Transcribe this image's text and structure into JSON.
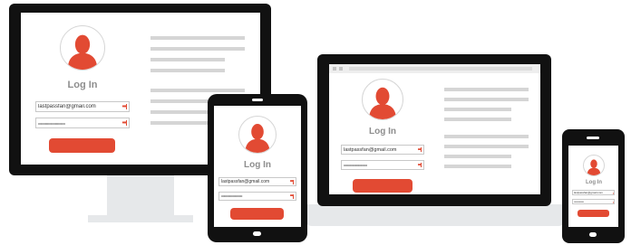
{
  "login": {
    "title": "Log In",
    "email_value": "lastpassfan@gmail.com",
    "password_value": "•••••••••••••••••••••••••••",
    "dots": "•••"
  },
  "phone_login": {
    "email_value": "lastpassfan@gmail.com",
    "password_value": "•••••••••••••••••"
  },
  "colors": {
    "accent": "#e24a33",
    "device": "#111111",
    "screen": "#ffffff",
    "stand": "#e6e8ea",
    "placeholder_line": "#d5d5d5",
    "title_text": "#8e8e8e"
  }
}
